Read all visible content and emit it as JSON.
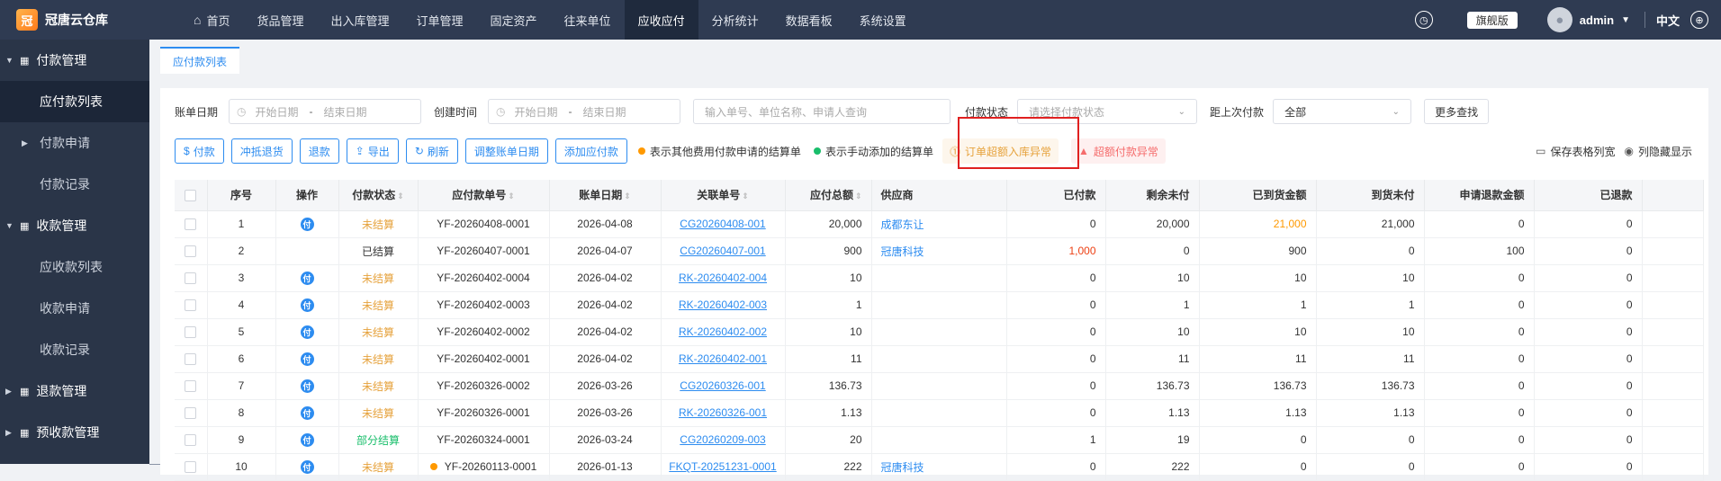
{
  "app": {
    "name": "冠唐云仓库",
    "logo_char": "冠"
  },
  "nav": [
    "首页",
    "货品管理",
    "出入库管理",
    "订单管理",
    "固定资产",
    "往来单位",
    "应收应付",
    "分析统计",
    "数据看板",
    "系统设置"
  ],
  "nav_active_index": 6,
  "topright": {
    "edition": "旗舰版",
    "user": "admin",
    "lang": "中文"
  },
  "sidebar": {
    "group1": "付款管理",
    "item_list": "应付款列表",
    "item_apply": "付款申请",
    "item_record": "付款记录",
    "group2": "收款管理",
    "item_recv_list": "应收款列表",
    "item_recv_apply": "收款申请",
    "item_recv_record": "收款记录",
    "group3": "退款管理",
    "group4": "预收款管理"
  },
  "tab": "应付款列表",
  "filters": {
    "bill_date_label": "账单日期",
    "start_ph": "开始日期",
    "end_ph": "结束日期",
    "create_label": "创建时间",
    "search_ph": "输入单号、单位名称、申请人查询",
    "pay_status_label": "付款状态",
    "pay_status_ph": "请选择付款状态",
    "last_pay_label": "距上次付款",
    "last_pay_value": "全部",
    "more": "更多查找"
  },
  "toolbar": {
    "pay": "付款",
    "offset": "冲抵退货",
    "refund": "退款",
    "export": "导出",
    "refresh": "刷新",
    "adjust": "调整账单日期",
    "add": "添加应付款",
    "legend_orange": "表示其他费用付款申请的结算单",
    "legend_green": "表示手动添加的结算单",
    "warn_order": "订单超额入库异常",
    "warn_pay": "超额付款异常",
    "save_cols": "保存表格列宽",
    "show_hidden": "列隐藏显示"
  },
  "colors": {
    "topbar": "#2f3b52",
    "sidebar": "#2a3548",
    "accent": "#2d8cf0",
    "unsettled": "#e6a23c",
    "partial": "#19be6b",
    "danger": "#f56c6c"
  },
  "table": {
    "headers": [
      "",
      "序号",
      "操作",
      "付款状态",
      "应付款单号",
      "账单日期",
      "关联单号",
      "应付总额",
      "供应商",
      "已付款",
      "剩余未付",
      "已到货金额",
      "到货未付",
      "申请退款金额",
      "已退款"
    ],
    "pay_label": "付",
    "rows": [
      {
        "no": "1",
        "op": true,
        "status": "未结算",
        "st": "un",
        "id": "YF-20260408-0001",
        "date": "2026-04-08",
        "ref": "CG20260408-001",
        "total": "20,000",
        "sup": "成都东让",
        "paid": "0",
        "paid_c": "",
        "remain": "20,000",
        "arrived": "21,000",
        "arr_c": "orange",
        "arr_unpaid": "21,000",
        "req_refund": "0",
        "refunded": "0",
        "dot": false
      },
      {
        "no": "2",
        "op": false,
        "status": "已结算",
        "st": "done",
        "id": "YF-20260407-0001",
        "date": "2026-04-07",
        "ref": "CG20260407-001",
        "total": "900",
        "sup": "冠唐科技",
        "paid": "1,000",
        "paid_c": "red",
        "remain": "0",
        "arrived": "900",
        "arr_c": "",
        "arr_unpaid": "0",
        "req_refund": "100",
        "refunded": "0",
        "dot": false
      },
      {
        "no": "3",
        "op": true,
        "status": "未结算",
        "st": "un",
        "id": "YF-20260402-0004",
        "date": "2026-04-02",
        "ref": "RK-20260402-004",
        "total": "10",
        "sup": "",
        "paid": "0",
        "paid_c": "",
        "remain": "10",
        "arrived": "10",
        "arr_c": "",
        "arr_unpaid": "10",
        "req_refund": "0",
        "refunded": "0",
        "dot": false
      },
      {
        "no": "4",
        "op": true,
        "status": "未结算",
        "st": "un",
        "id": "YF-20260402-0003",
        "date": "2026-04-02",
        "ref": "RK-20260402-003",
        "total": "1",
        "sup": "",
        "paid": "0",
        "paid_c": "",
        "remain": "1",
        "arrived": "1",
        "arr_c": "",
        "arr_unpaid": "1",
        "req_refund": "0",
        "refunded": "0",
        "dot": false
      },
      {
        "no": "5",
        "op": true,
        "status": "未结算",
        "st": "un",
        "id": "YF-20260402-0002",
        "date": "2026-04-02",
        "ref": "RK-20260402-002",
        "total": "10",
        "sup": "",
        "paid": "0",
        "paid_c": "",
        "remain": "10",
        "arrived": "10",
        "arr_c": "",
        "arr_unpaid": "10",
        "req_refund": "0",
        "refunded": "0",
        "dot": false
      },
      {
        "no": "6",
        "op": true,
        "status": "未结算",
        "st": "un",
        "id": "YF-20260402-0001",
        "date": "2026-04-02",
        "ref": "RK-20260402-001",
        "total": "11",
        "sup": "",
        "paid": "0",
        "paid_c": "",
        "remain": "11",
        "arrived": "11",
        "arr_c": "",
        "arr_unpaid": "11",
        "req_refund": "0",
        "refunded": "0",
        "dot": false
      },
      {
        "no": "7",
        "op": true,
        "status": "未结算",
        "st": "un",
        "id": "YF-20260326-0002",
        "date": "2026-03-26",
        "ref": "CG20260326-001",
        "total": "136.73",
        "sup": "",
        "paid": "0",
        "paid_c": "",
        "remain": "136.73",
        "arrived": "136.73",
        "arr_c": "",
        "arr_unpaid": "136.73",
        "req_refund": "0",
        "refunded": "0",
        "dot": false
      },
      {
        "no": "8",
        "op": true,
        "status": "未结算",
        "st": "un",
        "id": "YF-20260326-0001",
        "date": "2026-03-26",
        "ref": "RK-20260326-001",
        "total": "1.13",
        "sup": "",
        "paid": "0",
        "paid_c": "",
        "remain": "1.13",
        "arrived": "1.13",
        "arr_c": "",
        "arr_unpaid": "1.13",
        "req_refund": "0",
        "refunded": "0",
        "dot": false
      },
      {
        "no": "9",
        "op": true,
        "status": "部分结算",
        "st": "part",
        "id": "YF-20260324-0001",
        "date": "2026-03-24",
        "ref": "CG20260209-003",
        "total": "20",
        "sup": "",
        "paid": "1",
        "paid_c": "",
        "remain": "19",
        "arrived": "0",
        "arr_c": "",
        "arr_unpaid": "0",
        "req_refund": "0",
        "refunded": "0",
        "dot": false
      },
      {
        "no": "10",
        "op": true,
        "status": "未结算",
        "st": "un",
        "id": "YF-20260113-0001",
        "date": "2026-01-13",
        "ref": "FKQT-20251231-0001",
        "total": "222",
        "sup": "冠唐科技",
        "paid": "0",
        "paid_c": "",
        "remain": "222",
        "arrived": "0",
        "arr_c": "",
        "arr_unpaid": "0",
        "req_refund": "0",
        "refunded": "0",
        "dot": true
      }
    ]
  }
}
